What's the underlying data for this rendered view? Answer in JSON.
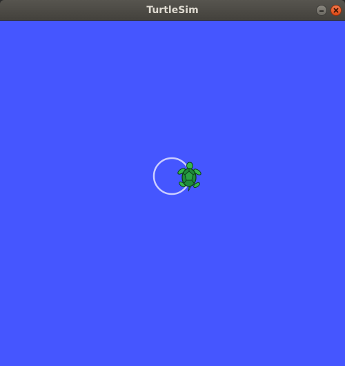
{
  "window": {
    "title": "TurtleSim"
  },
  "icons": {
    "minimize": "minimize-icon",
    "close": "close-icon",
    "turtle": "turtle-icon"
  },
  "colors": {
    "background": "#4556ff",
    "pen": "#e6e6ff",
    "turtle_shell": "#1f8a3b",
    "turtle_skin": "#35b54c",
    "titlebar": "#4a4843",
    "close_button": "#e95420"
  }
}
